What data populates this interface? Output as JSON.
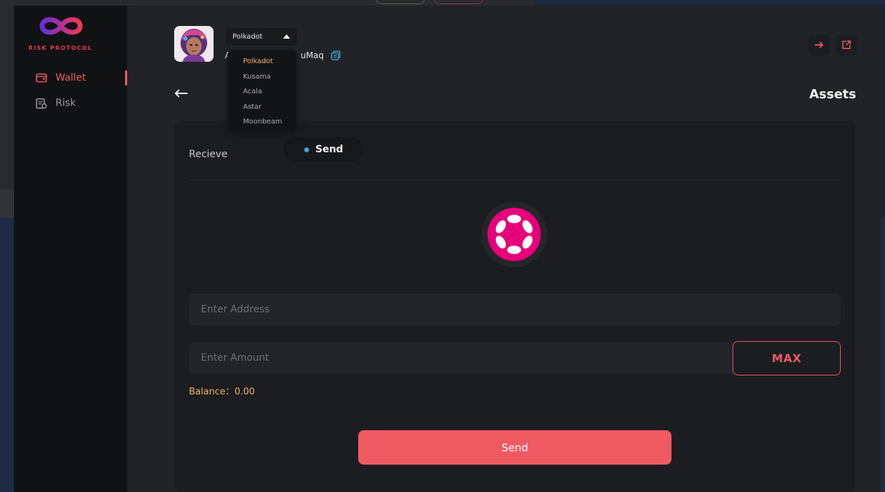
{
  "brand": {
    "name": "RISK PROTOCOL"
  },
  "sidebar": {
    "items": [
      {
        "label": "Wallet",
        "icon": "wallet-icon",
        "active": true
      },
      {
        "label": "Risk",
        "icon": "risk-icon",
        "active": false
      }
    ]
  },
  "header": {
    "network": {
      "selected": "Polkadot",
      "options": [
        "Polkadot",
        "Kusama",
        "Acala",
        "Astar",
        "Moonbeam"
      ]
    },
    "address": {
      "start": "A",
      "end": "uMaq"
    }
  },
  "page": {
    "title": "Assets"
  },
  "tabs": {
    "recieve": "Recieve",
    "send": "Send"
  },
  "form": {
    "address_placeholder": "Enter Address",
    "amount_placeholder": "Enter Amount",
    "max_label": "MAX",
    "balance": "Balance：0.00",
    "submit_label": "Send"
  },
  "colors": {
    "accent": "#ef5a62",
    "balance": "#f3b565",
    "tab_dot": "#3ea3d5",
    "token": "#e6007a"
  }
}
